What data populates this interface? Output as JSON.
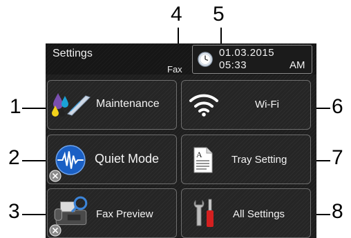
{
  "callouts": {
    "n1": "1",
    "n2": "2",
    "n3": "3",
    "n4": "4",
    "n5": "5",
    "n6": "6",
    "n7": "7",
    "n8": "8"
  },
  "header": {
    "title": "Settings",
    "mode": "Fax",
    "date": "01.03.2015",
    "time": "05:33",
    "ampm": "AM"
  },
  "buttons": {
    "maintenance": "Maintenance",
    "wifi": "Wi-Fi",
    "quiet_mode": "Quiet Mode",
    "tray_setting": "Tray Setting",
    "fax_preview": "Fax Preview",
    "all_settings": "All Settings"
  },
  "icons": {
    "maintenance": "ink-drops-icon",
    "wifi": "wifi-icon",
    "quiet_mode": "sound-wave-icon",
    "tray_setting": "paper-tray-icon",
    "fax_preview": "fax-machine-icon",
    "all_settings": "tools-icon",
    "clock": "clock-icon",
    "disabled": "x-circle-icon"
  },
  "colors": {
    "screen_bg": "#1e1e1e",
    "button_border": "#6f6f6f",
    "text": "#f4f4f4",
    "quiet_blue": "#1a5fc4",
    "tools_red": "#d42020"
  }
}
